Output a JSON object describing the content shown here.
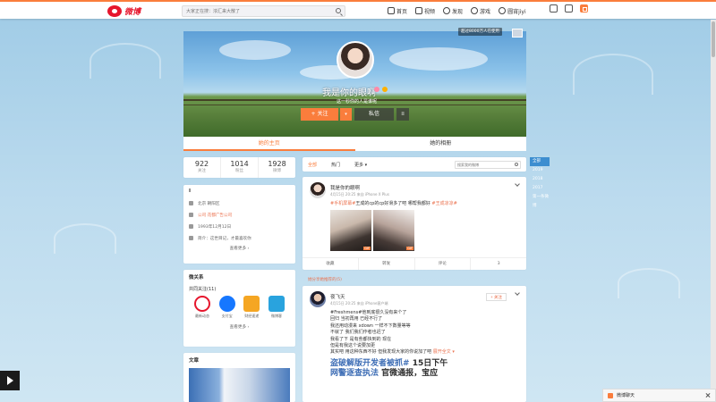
{
  "topbar": {
    "logo_text": "微博",
    "search_placeholder": "大家正在搜：浓汇来大散了",
    "nav": [
      {
        "label": "首页"
      },
      {
        "label": "视频"
      },
      {
        "label": "发现"
      },
      {
        "label": "游戏"
      },
      {
        "label": "圆宵jiyi"
      }
    ]
  },
  "profile": {
    "cover_badge": "超过8000万人在使用",
    "username": "我是你的眼啊",
    "desc": "这一秒你的人是谁呢",
    "follow_label": "+ 关注",
    "message_label": "私信",
    "more_label": "≡"
  },
  "tabs": [
    {
      "label": "她的主页"
    },
    {
      "label": "她的相册"
    }
  ],
  "stats": [
    {
      "num": "922",
      "label": "关注"
    },
    {
      "num": "1014",
      "label": "粉丝"
    },
    {
      "num": "1928",
      "label": "微博"
    }
  ],
  "info": {
    "title": "I",
    "rows": [
      {
        "text": "北京 朝阳区",
        "link": false
      },
      {
        "text": "公司 花都广告公司",
        "link": true
      },
      {
        "text": "1993年12月12日",
        "link": false
      },
      {
        "text": "简介：这世目记，才最喜欢你",
        "link": false
      }
    ],
    "more": "查看更多 ›"
  },
  "friends": {
    "title": "微关系",
    "common": "共同关注(11)",
    "apps": [
      {
        "name": "最新动态",
        "color": "#e6162d"
      },
      {
        "name": "支付宝",
        "color": "#1677ff"
      },
      {
        "name": "财经速递",
        "color": "#f5a623"
      },
      {
        "name": "微博客",
        "color": "#29a3de"
      }
    ],
    "more": "查看更多 ›"
  },
  "docs": {
    "title": "文章"
  },
  "feed": {
    "tabs": [
      {
        "label": "全部"
      },
      {
        "label": "热门"
      },
      {
        "label": "更多 ▾"
      }
    ],
    "search_placeholder": "搜索我的微博"
  },
  "post1": {
    "name": "我是你的眼啊",
    "time": "4月15日 20:25 来自 iPhone X Plus",
    "text_tag": "#手机屏幕#",
    "text": "王成的cp的cp好滑多了吧 哪帮我都好 ",
    "text_tag2": "#王成凉凉#",
    "gif_label": "GIF",
    "actions": [
      {
        "label": "收藏"
      },
      {
        "label": "转发"
      },
      {
        "label": "评论"
      },
      {
        "label": "3"
      }
    ]
  },
  "shared_note": "她分享她推荐的(5)",
  "post2": {
    "name": "夜飞天",
    "time": "4月15日 20:25 来自 iPhone客户端",
    "follow_label": "+ 关注",
    "lines": [
      "#Freshmens#他到底很久没有来个了",
      "回归 当初再用 已经不行了",
      "我还用动漫来 xdown 一样不下数量等等",
      "不就了 我们我们作者也迟了",
      "我看了下 是有些都快到的 现在",
      "但是有我这个说要加更",
      "其实吧 用这种东西不好 但我发现大家的你说加了吧"
    ],
    "expand_label": "展开全文 ▾",
    "img_line1": "盗破解版开发者被抓#",
    "img_line1b": "15日下午",
    "img_line2": "网警逐查执法",
    "img_line2b": "官微通报，宝应"
  },
  "right_side": [
    {
      "label": "全部"
    },
    {
      "label": "2019"
    },
    {
      "label": "2018"
    },
    {
      "label": "2017"
    },
    {
      "label": "第一条微博"
    }
  ],
  "chat": {
    "label": "微博聊天"
  }
}
